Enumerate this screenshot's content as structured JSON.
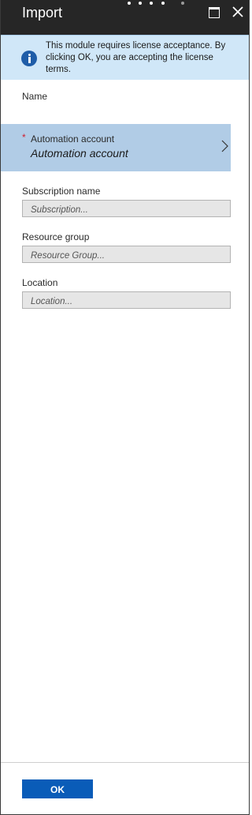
{
  "header": {
    "title": "Import",
    "page_indicator": {
      "count": 5,
      "active_index": 4
    },
    "maximize_icon": "maximize-icon",
    "close_icon": "close-icon"
  },
  "banner": {
    "icon": "info-icon",
    "text": "This module requires license acceptance. By clicking OK, you are accepting the license terms.",
    "background_color": "#d0e7f8",
    "icon_color": "#1f5da8"
  },
  "form": {
    "name_label": "Name",
    "automation_account": {
      "required_marker": "*",
      "label": "Automation account",
      "value": "Automation account",
      "chevron_icon": "chevron-right-icon",
      "background_color": "#b1cce6"
    },
    "subscription": {
      "label": "Subscription name",
      "placeholder": "Subscription..."
    },
    "resource_group": {
      "label": "Resource group",
      "placeholder": "Resource Group..."
    },
    "location": {
      "label": "Location",
      "placeholder": "Location..."
    }
  },
  "footer": {
    "ok_label": "OK",
    "ok_color": "#0a5cb8"
  }
}
